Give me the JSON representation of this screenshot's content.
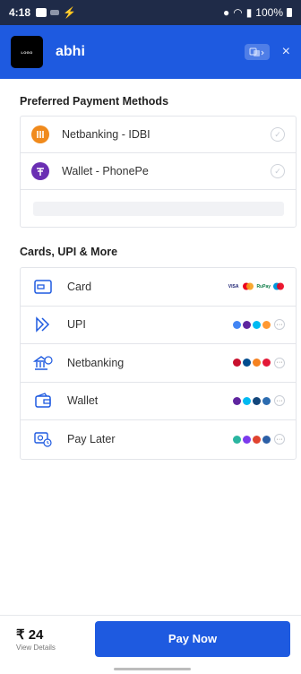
{
  "status_bar": {
    "time": "4:18",
    "battery": "100%"
  },
  "header": {
    "logo_text": "LOGO",
    "merchant_name": "abhi",
    "lang_icon": "translate-icon",
    "close_symbol": "×"
  },
  "preferred": {
    "title": "Preferred Payment Methods",
    "items": [
      {
        "label": "Netbanking - IDBI",
        "icon": "idbi-bank-icon",
        "color": "#f08a1c"
      },
      {
        "label": "Wallet - PhonePe",
        "icon": "phonepe-icon",
        "color": "#6a2fb3"
      }
    ]
  },
  "methods": {
    "title": "Cards, UPI & More",
    "items": [
      {
        "label": "Card",
        "icon": "card-icon"
      },
      {
        "label": "UPI",
        "icon": "upi-icon"
      },
      {
        "label": "Netbanking",
        "icon": "bank-icon"
      },
      {
        "label": "Wallet",
        "icon": "wallet-icon"
      },
      {
        "label": "Pay Later",
        "icon": "paylater-icon"
      }
    ],
    "card_logos": [
      "VISA",
      "Mastercard",
      "RuPay",
      "Maestro"
    ],
    "more_symbol": "···"
  },
  "footer": {
    "amount": "₹ 24",
    "view_details": "View Details",
    "pay_button": "Pay Now"
  },
  "colors": {
    "accent": "#1e5ae0",
    "status_bar": "#1f2b48"
  }
}
